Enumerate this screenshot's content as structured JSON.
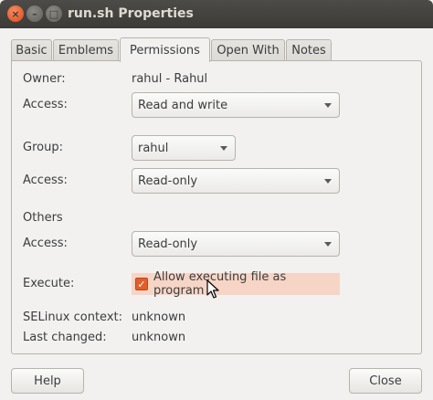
{
  "window": {
    "title": "run.sh Properties",
    "close_glyph": "×",
    "minimize_glyph": "–",
    "maximize_glyph": "□"
  },
  "tabs": [
    {
      "label": "Basic"
    },
    {
      "label": "Emblems"
    },
    {
      "label": "Permissions"
    },
    {
      "label": "Open With"
    },
    {
      "label": "Notes"
    }
  ],
  "active_tab": "Permissions",
  "permissions": {
    "owner_label": "Owner:",
    "owner_value": "rahul - Rahul",
    "owner_access_label": "Access:",
    "owner_access_value": "Read and write",
    "group_label": "Group:",
    "group_value": "rahul",
    "group_access_label": "Access:",
    "group_access_value": "Read-only",
    "others_label": "Others",
    "others_access_label": "Access:",
    "others_access_value": "Read-only",
    "execute_label": "Execute:",
    "execute_checkbox_label": "Allow executing file as program",
    "execute_checked": true,
    "checkmark_glyph": "✓",
    "selinux_label": "SELinux context:",
    "selinux_value": "unknown",
    "last_changed_label": "Last changed:",
    "last_changed_value": "unknown"
  },
  "buttons": {
    "help": "Help",
    "close": "Close"
  },
  "colors": {
    "titlebar": "#3c3b37",
    "close_button": "#dd4814",
    "checkbox": "#e15f2a",
    "execute_highlight": "#f7d5c6",
    "window_bg": "#f2f1f0"
  }
}
